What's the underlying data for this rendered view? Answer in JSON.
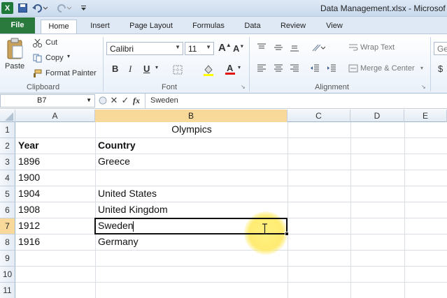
{
  "window": {
    "title": "Data Management.xlsx - Microsof"
  },
  "tabs": [
    "File",
    "Home",
    "Insert",
    "Page Layout",
    "Formulas",
    "Data",
    "Review",
    "View"
  ],
  "clipboard": {
    "paste": "Paste",
    "cut": "Cut",
    "copy": "Copy",
    "format_painter": "Format Painter",
    "label": "Clipboard"
  },
  "font": {
    "name": "Calibri",
    "size": "11",
    "label": "Font",
    "bold": "B",
    "italic": "I",
    "underline": "U"
  },
  "alignment": {
    "wrap_text": "Wrap Text",
    "merge_center": "Merge & Center",
    "label": "Alignment"
  },
  "number": {
    "format_partial": "Ger",
    "currency": "$"
  },
  "formula_bar": {
    "name_box": "B7",
    "fx": "fx",
    "value": "Sweden"
  },
  "columns": [
    "A",
    "B",
    "C",
    "D",
    "E"
  ],
  "rows": [
    "1",
    "2",
    "3",
    "4",
    "5",
    "6",
    "7",
    "8",
    "9",
    "10",
    "11"
  ],
  "sheet": {
    "title": "Olympics",
    "headers": {
      "year": "Year",
      "country": "Country"
    },
    "records": [
      {
        "year": "1896",
        "country": "Greece"
      },
      {
        "year": "1900",
        "country": ""
      },
      {
        "year": "1904",
        "country": "United States"
      },
      {
        "year": "1908",
        "country": "United Kingdom"
      },
      {
        "year": "1912",
        "country": "Sweden"
      },
      {
        "year": "1916",
        "country": "Germany"
      }
    ]
  },
  "accent_colors": {
    "file_tab": "#2a7a3e",
    "selection_header": "#f9d99a",
    "font_color_bar": "#e01010"
  }
}
